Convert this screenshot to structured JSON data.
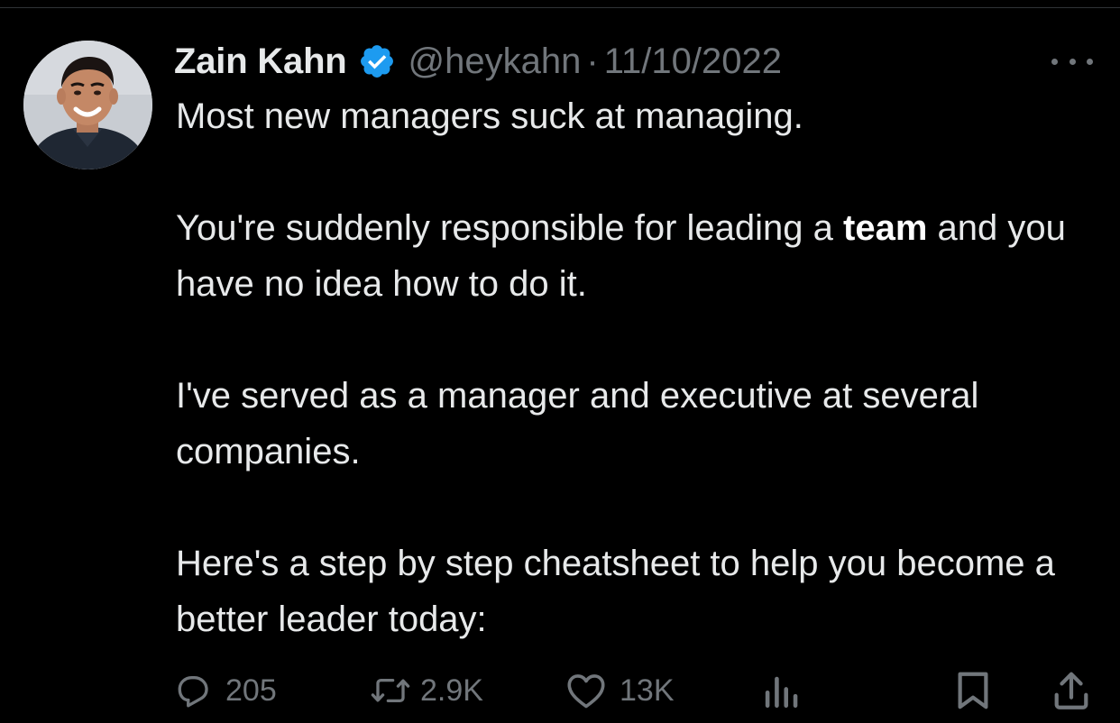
{
  "author": {
    "name": "Zain Kahn",
    "handle": "@heykahn",
    "separator": "·",
    "date": "11/10/2022",
    "verified": true
  },
  "tweet": {
    "p1": "Most new managers suck at managing.",
    "p2_before": "You're suddenly responsible for leading a ",
    "p2_bold": "team",
    "p2_after": " and you have no idea how to do it.",
    "p3": "I've served as a manager and executive at several companies.",
    "p4": "Here's a step by step cheatsheet to help you become a better leader today:"
  },
  "actions": {
    "replies": "205",
    "reposts": "2.9K",
    "likes": "13K"
  },
  "icons": {
    "verified": "verified-badge-icon",
    "more": "more-icon",
    "reply": "reply-icon",
    "repost": "repost-icon",
    "like": "like-icon",
    "views": "views-icon",
    "bookmark": "bookmark-icon",
    "share": "share-icon"
  },
  "colors": {
    "background": "#000000",
    "text": "#e7e9ea",
    "secondary": "#71767b",
    "verified": "#1d9bf0"
  }
}
